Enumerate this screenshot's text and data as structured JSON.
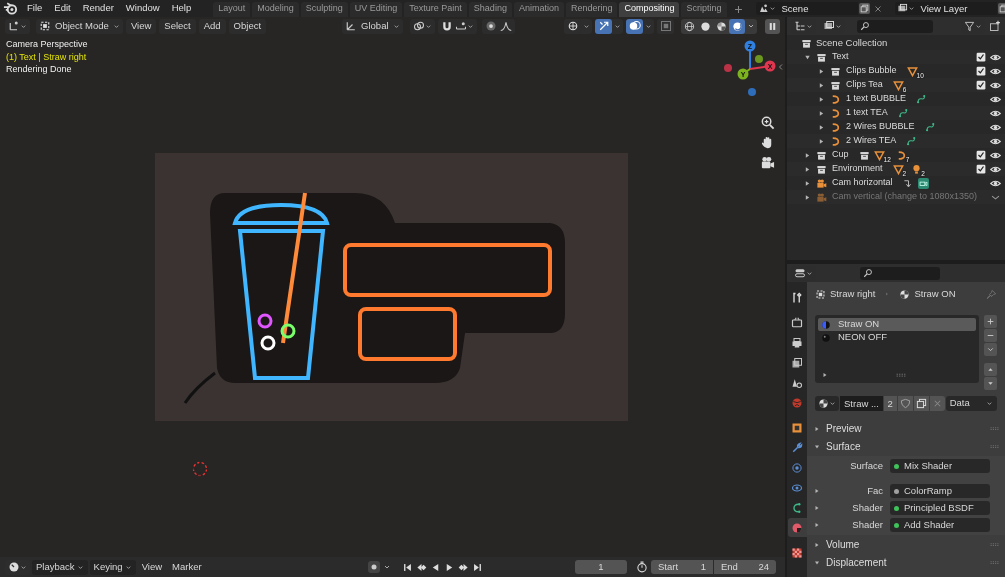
{
  "menu": [
    "File",
    "Edit",
    "Render",
    "Window",
    "Help"
  ],
  "workspaces": [
    {
      "label": "Layout",
      "selected": false
    },
    {
      "label": "Modeling",
      "selected": false
    },
    {
      "label": "Sculpting",
      "selected": false
    },
    {
      "label": "UV Editing",
      "selected": false
    },
    {
      "label": "Texture Paint",
      "selected": false
    },
    {
      "label": "Shading",
      "selected": false
    },
    {
      "label": "Animation",
      "selected": false
    },
    {
      "label": "Rendering",
      "selected": false
    },
    {
      "label": "Compositing",
      "selected": true
    },
    {
      "label": "Scripting",
      "selected": false
    }
  ],
  "scene": {
    "name": "Scene"
  },
  "view_layer": {
    "name": "View Layer"
  },
  "viewport": {
    "mode": "Object Mode",
    "menus": [
      "View",
      "Select",
      "Add",
      "Object"
    ],
    "orientation": "Global",
    "toggles": [
      {
        "kind": "visibility",
        "active": false
      },
      {
        "kind": "gizmo",
        "active": true
      },
      {
        "kind": "overlay",
        "active": true
      },
      {
        "kind": "xray",
        "active": false
      }
    ],
    "shading": [
      {
        "kind": "wireframe",
        "selected": false
      },
      {
        "kind": "solid",
        "selected": false
      },
      {
        "kind": "material",
        "selected": false
      },
      {
        "kind": "rendered",
        "selected": true
      }
    ],
    "info": [
      {
        "text": "Camera Perspective",
        "kind": "plain"
      },
      {
        "text": "(1) Text | Straw right",
        "kind": "active"
      },
      {
        "text": "Rendering Done",
        "kind": "plain"
      }
    ],
    "axes": [
      {
        "label": "Z",
        "color": "#2f80e0"
      },
      {
        "label": "X",
        "color": "#e0364f"
      },
      {
        "label": "Y",
        "color": "#7cb31e"
      }
    ]
  },
  "outliner": {
    "root": "Scene Collection",
    "items": [
      {
        "label": "Text",
        "kind": "collection",
        "expanded": true,
        "checked": true,
        "disabled": false,
        "children": [
          {
            "label": "Clips Bubble",
            "kind": "collection",
            "expanded": false,
            "checked": true,
            "disabled": false,
            "badges": [
              {
                "kind": "mesh",
                "count": "10"
              }
            ]
          },
          {
            "label": "Clips Tea",
            "kind": "collection",
            "expanded": false,
            "checked": true,
            "disabled": false,
            "badges": [
              {
                "kind": "mesh",
                "count": "6"
              }
            ]
          },
          {
            "label": "1 text BUBBLE",
            "kind": "curve",
            "expanded": false,
            "disabled": false,
            "badges": [
              {
                "kind": "curve_data"
              }
            ]
          },
          {
            "label": "1 text TEA",
            "kind": "curve",
            "expanded": false,
            "disabled": false,
            "badges": [
              {
                "kind": "curve_data"
              }
            ]
          },
          {
            "label": "2 Wires BUBBLE",
            "kind": "curve",
            "expanded": false,
            "disabled": false,
            "badges": [
              {
                "kind": "curve_data"
              }
            ]
          },
          {
            "label": "2 Wires TEA",
            "kind": "curve",
            "expanded": false,
            "disabled": false,
            "badges": [
              {
                "kind": "curve_data"
              }
            ]
          }
        ]
      },
      {
        "label": "Cup",
        "kind": "collection",
        "expanded": false,
        "checked": true,
        "disabled": false,
        "badges": [
          {
            "kind": "collection"
          },
          {
            "kind": "mesh",
            "count": "12"
          },
          {
            "kind": "curve",
            "count": "7"
          }
        ]
      },
      {
        "label": "Environment",
        "kind": "collection",
        "expanded": false,
        "checked": true,
        "disabled": false,
        "badges": [
          {
            "kind": "mesh",
            "count": "2"
          },
          {
            "kind": "light",
            "count": "2"
          }
        ]
      },
      {
        "label": "Cam horizontal",
        "kind": "camera",
        "expanded": false,
        "disabled": false,
        "badges": [
          {
            "kind": "arrow"
          },
          {
            "kind": "camera_data"
          }
        ]
      },
      {
        "label": "Cam vertical (change to 1080x1350)",
        "kind": "camera",
        "expanded": false,
        "disabled": true
      }
    ]
  },
  "properties": {
    "object": "Straw right",
    "material": "Straw ON",
    "tabs": [
      {
        "kind": "tool",
        "selected": false
      },
      {
        "kind": "render",
        "selected": false
      },
      {
        "kind": "output",
        "selected": false
      },
      {
        "kind": "view_layer",
        "selected": false
      },
      {
        "kind": "scene",
        "selected": false
      },
      {
        "kind": "world",
        "selected": false
      },
      {
        "kind": "object",
        "selected": false
      },
      {
        "kind": "modifier",
        "selected": false
      },
      {
        "kind": "particles",
        "selected": false
      },
      {
        "kind": "physics",
        "selected": false
      },
      {
        "kind": "data",
        "selected": false
      },
      {
        "kind": "material",
        "selected": true
      },
      {
        "kind": "texture",
        "selected": false
      }
    ],
    "slots": [
      {
        "name": "Straw ON",
        "selected": true
      },
      {
        "name": "NEON OFF",
        "selected": false
      }
    ],
    "material_name": "Straw ...",
    "users": "2",
    "link": "Data",
    "panels": [
      {
        "title": "Preview",
        "expanded": false
      },
      {
        "title": "Surface",
        "expanded": true,
        "rows": [
          {
            "label": "Surface",
            "value": "Mix Shader",
            "color": "#3fc25a",
            "expandable": false
          },
          {
            "label": "Fac",
            "value": "ColorRamp",
            "color": "#a0a0a0",
            "expandable": true
          },
          {
            "label": "Shader",
            "value": "Principled BSDF",
            "color": "#3fc25a",
            "expandable": true
          },
          {
            "label": "Shader",
            "value": "Add Shader",
            "color": "#3fc25a",
            "expandable": true
          }
        ]
      },
      {
        "title": "Volume",
        "expanded": false
      },
      {
        "title": "Displacement",
        "expanded": true
      }
    ]
  },
  "timeline": {
    "menus": [
      "Playback",
      "Keying",
      "View",
      "Marker"
    ],
    "frame": "1",
    "start_label": "Start",
    "start": "1",
    "end_label": "End",
    "end": "24"
  }
}
